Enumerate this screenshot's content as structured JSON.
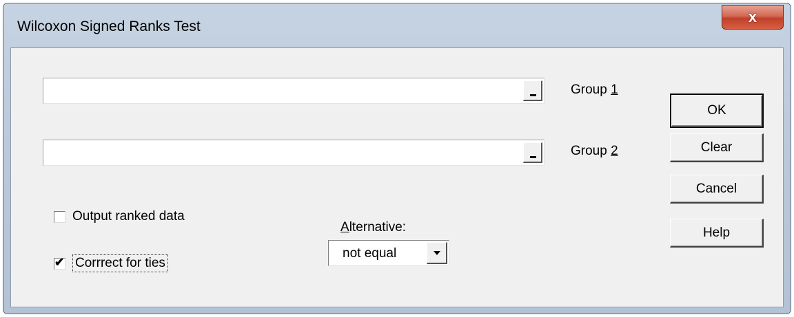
{
  "window": {
    "title": "Wilcoxon Signed Ranks Test",
    "close_glyph": "x"
  },
  "group1": {
    "label_prefix": "Group ",
    "label_key": "1",
    "value": ""
  },
  "group2": {
    "label_prefix": "Group ",
    "label_key": "2",
    "value": ""
  },
  "buttons": {
    "ok": "OK",
    "clear": "Clear",
    "cancel": "Cancel",
    "help": "Help"
  },
  "options": {
    "output_ranked": {
      "label": "Output ranked data",
      "checked": false
    },
    "correct_ties": {
      "label": "Corrrect for ties",
      "checked": true
    }
  },
  "alternative": {
    "label_key": "A",
    "label_rest": "lternative:",
    "selected": "not equal"
  },
  "icons": {
    "close": "close-icon",
    "collapse": "range-collapse-icon",
    "dropdown": "chevron-down-icon",
    "check": "checkmark-icon"
  }
}
